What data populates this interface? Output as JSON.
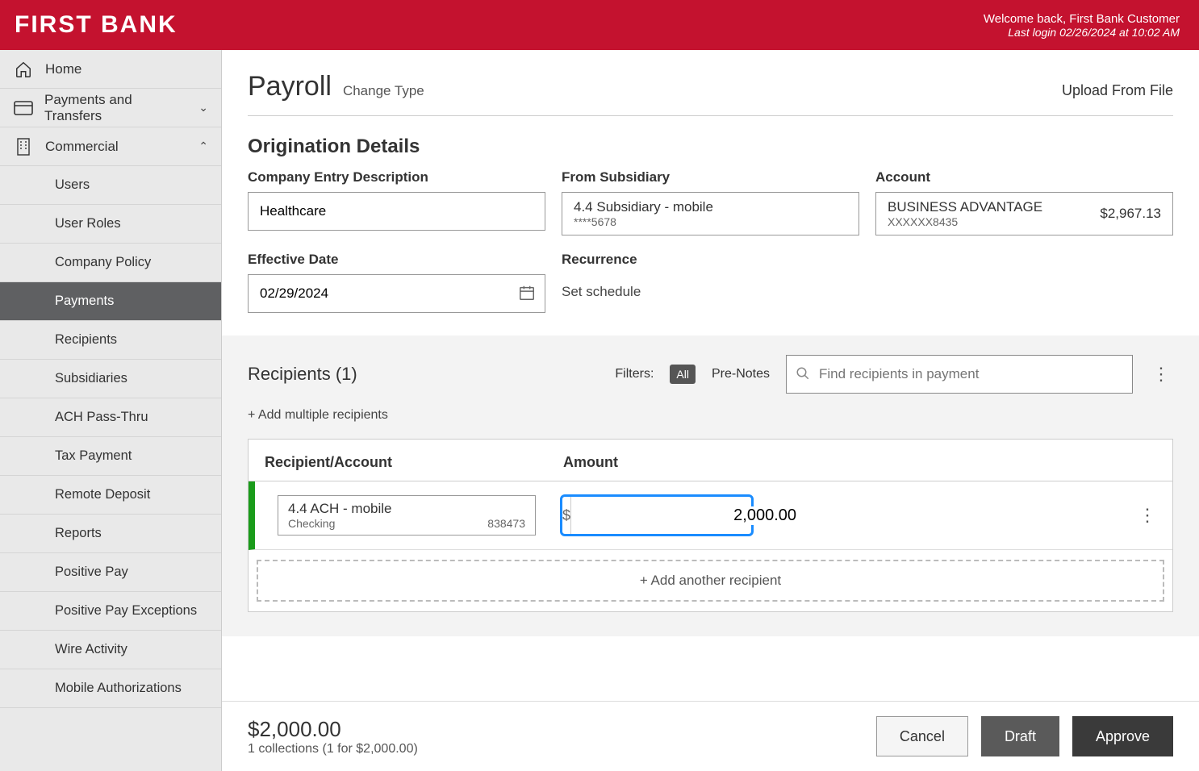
{
  "brand": "FIRST BANK",
  "welcome": {
    "line1": "Welcome back, First Bank Customer",
    "line2": "Last login 02/26/2024 at 10:02 AM"
  },
  "nav": {
    "home": "Home",
    "payments_transfers": "Payments and Transfers",
    "commercial": "Commercial",
    "subs": {
      "users": "Users",
      "user_roles": "User Roles",
      "company_policy": "Company Policy",
      "payments": "Payments",
      "recipients": "Recipients",
      "subsidiaries": "Subsidiaries",
      "ach_passthru": "ACH Pass-Thru",
      "tax_payment": "Tax Payment",
      "remote_deposit": "Remote Deposit",
      "reports": "Reports",
      "positive_pay": "Positive Pay",
      "positive_pay_exceptions": "Positive Pay Exceptions",
      "wire_activity": "Wire Activity",
      "mobile_authorizations": "Mobile Authorizations"
    }
  },
  "page": {
    "title": "Payroll",
    "change_type": "Change Type",
    "upload": "Upload From File"
  },
  "origination": {
    "section_title": "Origination Details",
    "company_entry_label": "Company Entry Description",
    "company_entry_value": "Healthcare",
    "from_subsidiary_label": "From Subsidiary",
    "subsidiary_name": "4.4 Subsidiary - mobile",
    "subsidiary_mask": "****5678",
    "account_label": "Account",
    "account_name": "BUSINESS ADVANTAGE",
    "account_mask": "XXXXXX8435",
    "account_balance": "$2,967.13",
    "effective_date_label": "Effective Date",
    "effective_date_value": "02/29/2024",
    "recurrence_label": "Recurrence",
    "recurrence_link": "Set schedule"
  },
  "recipients": {
    "title": "Recipients (1)",
    "filters_label": "Filters:",
    "filter_all": "All",
    "filter_prenotes": "Pre-Notes",
    "search_placeholder": "Find recipients in payment",
    "add_multiple": "+ Add multiple recipients",
    "col_account": "Recipient/Account",
    "col_amount": "Amount",
    "row": {
      "name": "4.4 ACH - mobile",
      "type": "Checking",
      "number": "838473",
      "amount": "2,000.00"
    },
    "add_another": "+ Add another recipient"
  },
  "footer": {
    "total": "$2,000.00",
    "summary": "1 collections (1 for $2,000.00)",
    "cancel": "Cancel",
    "draft": "Draft",
    "approve": "Approve"
  }
}
